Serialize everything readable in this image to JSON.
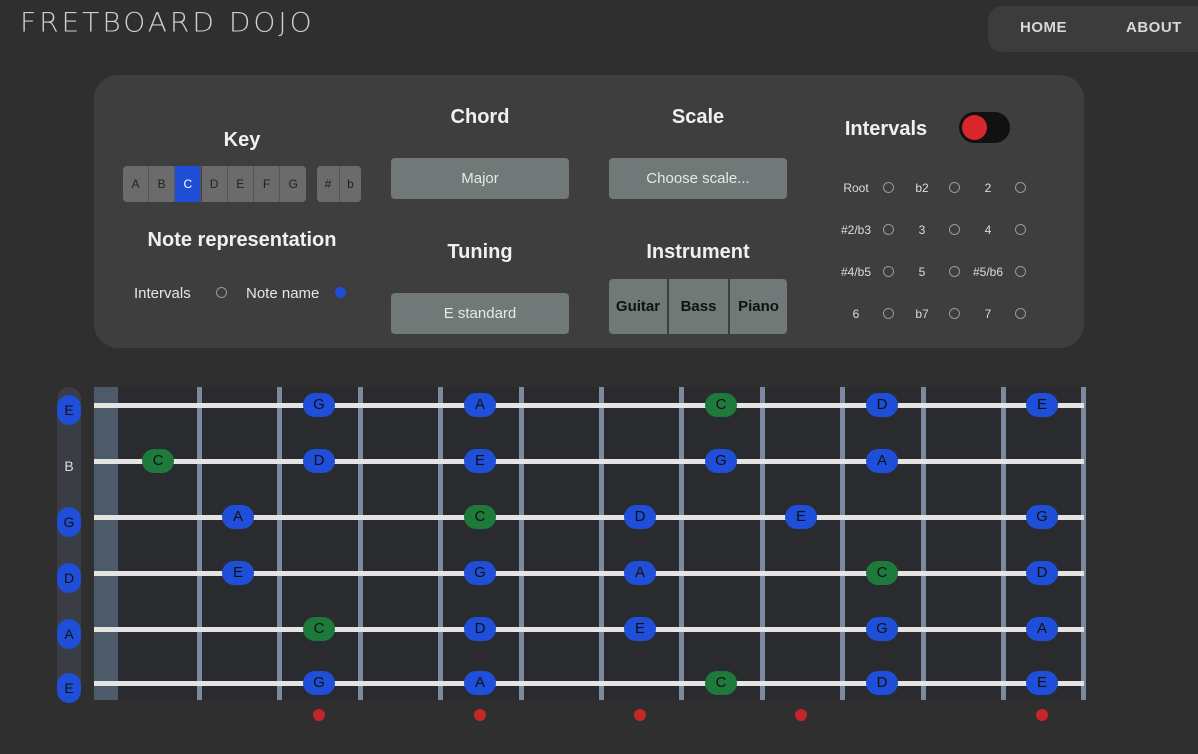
{
  "app": {
    "logo": "FRETBOARD DOJO"
  },
  "nav": [
    {
      "label": "HOME"
    },
    {
      "label": "ABOUT"
    }
  ],
  "key": {
    "title": "Key",
    "notes": [
      "A",
      "B",
      "C",
      "D",
      "E",
      "F",
      "G"
    ],
    "selected": "C",
    "accidentals": [
      "#",
      "b"
    ]
  },
  "chord": {
    "title": "Chord",
    "value": "Major"
  },
  "scale": {
    "title": "Scale",
    "value": "Choose scale..."
  },
  "tuning": {
    "title": "Tuning",
    "value": "E standard"
  },
  "instrument": {
    "title": "Instrument",
    "options": [
      "Guitar",
      "Bass",
      "Piano"
    ]
  },
  "note_representation": {
    "title": "Note representation",
    "options": [
      {
        "label": "Intervals",
        "selected": false
      },
      {
        "label": "Note name",
        "selected": true
      }
    ]
  },
  "intervals": {
    "title": "Intervals",
    "toggle_on": true,
    "items": [
      "Root",
      "b2",
      "2",
      "#2/b3",
      "3",
      "4",
      "#4/b5",
      "5",
      "#5/b6",
      "6",
      "b7",
      "7"
    ]
  },
  "fretboard": {
    "strings": [
      {
        "open": "E",
        "highlighted": true,
        "notes": [
          {
            "fret": 3,
            "n": "G"
          },
          {
            "fret": 5,
            "n": "A"
          },
          {
            "fret": 8,
            "n": "C",
            "root": true
          },
          {
            "fret": 10,
            "n": "D"
          },
          {
            "fret": 12,
            "n": "E"
          }
        ]
      },
      {
        "open": "B",
        "highlighted": false,
        "notes": [
          {
            "fret": 1,
            "n": "C",
            "root": true
          },
          {
            "fret": 3,
            "n": "D"
          },
          {
            "fret": 5,
            "n": "E"
          },
          {
            "fret": 8,
            "n": "G"
          },
          {
            "fret": 10,
            "n": "A"
          }
        ]
      },
      {
        "open": "G",
        "highlighted": true,
        "notes": [
          {
            "fret": 2,
            "n": "A"
          },
          {
            "fret": 5,
            "n": "C",
            "root": true
          },
          {
            "fret": 7,
            "n": "D"
          },
          {
            "fret": 9,
            "n": "E"
          },
          {
            "fret": 12,
            "n": "G"
          }
        ]
      },
      {
        "open": "D",
        "highlighted": true,
        "notes": [
          {
            "fret": 2,
            "n": "E"
          },
          {
            "fret": 5,
            "n": "G"
          },
          {
            "fret": 7,
            "n": "A"
          },
          {
            "fret": 10,
            "n": "C",
            "root": true
          },
          {
            "fret": 12,
            "n": "D"
          }
        ]
      },
      {
        "open": "A",
        "highlighted": true,
        "notes": [
          {
            "fret": 3,
            "n": "C",
            "root": true
          },
          {
            "fret": 5,
            "n": "D"
          },
          {
            "fret": 7,
            "n": "E"
          },
          {
            "fret": 10,
            "n": "G"
          },
          {
            "fret": 12,
            "n": "A"
          }
        ]
      },
      {
        "open": "E",
        "highlighted": true,
        "notes": [
          {
            "fret": 3,
            "n": "G"
          },
          {
            "fret": 5,
            "n": "A"
          },
          {
            "fret": 8,
            "n": "C",
            "root": true
          },
          {
            "fret": 10,
            "n": "D"
          },
          {
            "fret": 12,
            "n": "E"
          }
        ]
      }
    ],
    "inlay_frets": [
      3,
      5,
      7,
      9,
      12
    ]
  },
  "colors": {
    "accent": "#1f4ed8",
    "root": "#1e7a3a",
    "toggle": "#d8262b"
  }
}
